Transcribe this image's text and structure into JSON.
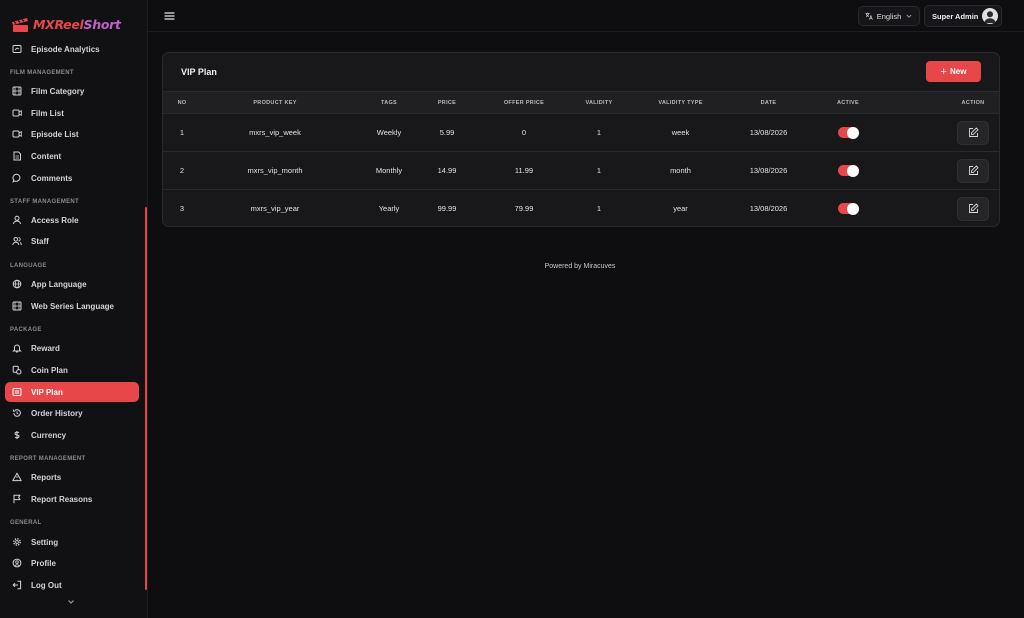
{
  "brand": {
    "logo_text_main": "MXReel",
    "logo_text_accent": "Short",
    "colors": {
      "accent": "#e8474a",
      "logo_accent": "#c062c7",
      "background": "#0e0e10"
    }
  },
  "sidebar": {
    "top_item": {
      "label": "Episode Analytics",
      "icon": "analytics-icon"
    },
    "sections": [
      {
        "title": "FILM MANAGEMENT",
        "items": [
          {
            "label": "Film Category",
            "icon": "film-category-icon"
          },
          {
            "label": "Film List",
            "icon": "film-list-icon"
          },
          {
            "label": "Episode List",
            "icon": "episode-list-icon"
          },
          {
            "label": "Content",
            "icon": "content-icon"
          },
          {
            "label": "Comments",
            "icon": "comments-icon"
          }
        ]
      },
      {
        "title": "STAFF MANAGEMENT",
        "items": [
          {
            "label": "Access Role",
            "icon": "access-role-icon"
          },
          {
            "label": "Staff",
            "icon": "staff-icon"
          }
        ]
      },
      {
        "title": "LANGUAGE",
        "items": [
          {
            "label": "App Language",
            "icon": "globe-icon"
          },
          {
            "label": "Web Series Language",
            "icon": "web-series-language-icon"
          }
        ]
      },
      {
        "title": "PACKAGE",
        "items": [
          {
            "label": "Reward",
            "icon": "reward-icon"
          },
          {
            "label": "Coin Plan",
            "icon": "coin-plan-icon"
          },
          {
            "label": "VIP Plan",
            "icon": "vip-plan-icon",
            "active": true
          },
          {
            "label": "Order History",
            "icon": "history-icon"
          },
          {
            "label": "Currency",
            "icon": "dollar-icon"
          }
        ]
      },
      {
        "title": "REPORT MANAGEMENT",
        "items": [
          {
            "label": "Reports",
            "icon": "warning-icon"
          },
          {
            "label": "Report Reasons",
            "icon": "flag-icon"
          }
        ]
      },
      {
        "title": "GENERAL",
        "items": [
          {
            "label": "Setting",
            "icon": "gear-icon"
          },
          {
            "label": "Profile",
            "icon": "profile-icon"
          },
          {
            "label": "Log Out",
            "icon": "logout-icon"
          }
        ]
      }
    ]
  },
  "topbar": {
    "language": "English",
    "user": "Super Admin"
  },
  "page": {
    "title": "VIP Plan",
    "new_button": "New",
    "columns": [
      "NO",
      "PRODUCT KEY",
      "TAGS",
      "PRICE",
      "OFFER PRICE",
      "VALIDITY",
      "VALIDITY TYPE",
      "DATE",
      "ACTIVE",
      "ACTION"
    ],
    "rows": [
      {
        "no": "1",
        "product_key": "mxrs_vip_week",
        "tags": "Weekly",
        "price": "5.99",
        "offer_price": "0",
        "validity": "1",
        "validity_type": "week",
        "date": "13/08/2026",
        "active": true
      },
      {
        "no": "2",
        "product_key": "mxrs_vip_month",
        "tags": "Monthly",
        "price": "14.99",
        "offer_price": "11.99",
        "validity": "1",
        "validity_type": "month",
        "date": "13/08/2026",
        "active": true
      },
      {
        "no": "3",
        "product_key": "mxrs_vip_year",
        "tags": "Yearly",
        "price": "99.99",
        "offer_price": "79.99",
        "validity": "1",
        "validity_type": "year",
        "date": "13/08/2026",
        "active": true
      }
    ]
  },
  "footer": {
    "text": "Powered by Miracuves"
  }
}
